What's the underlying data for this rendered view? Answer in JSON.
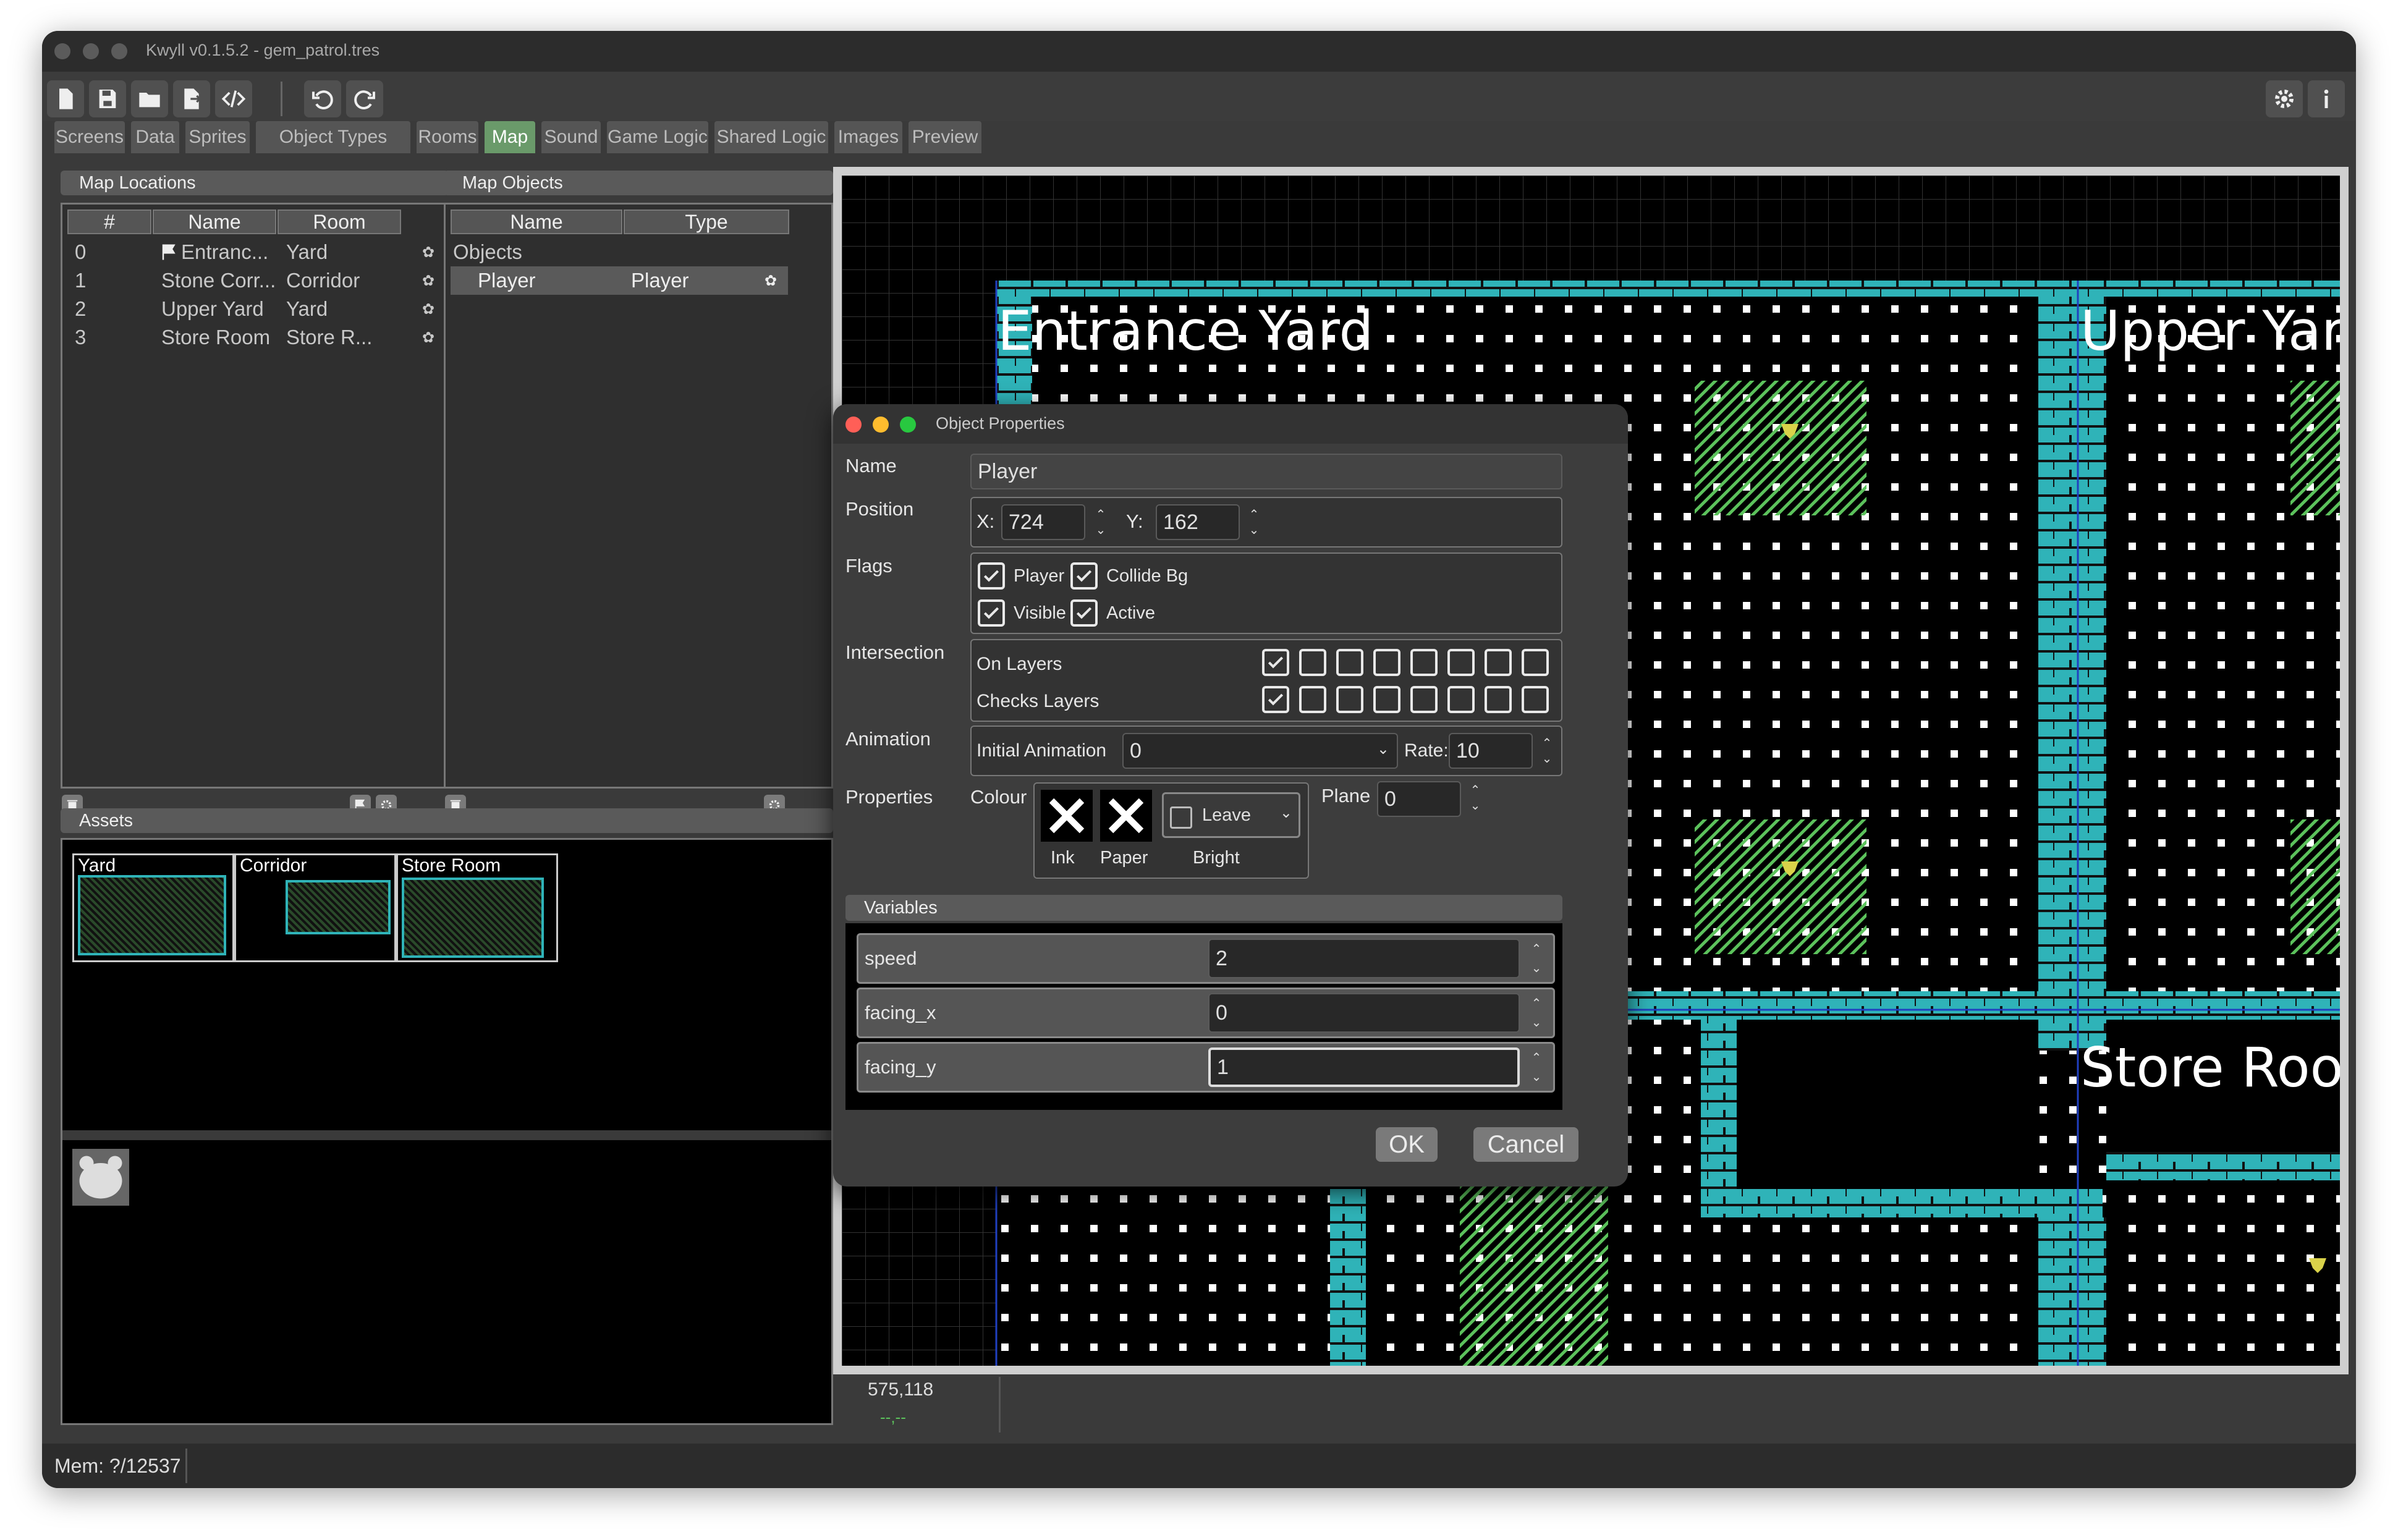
{
  "window": {
    "title": "Kwyll v0.1.5.2 - gem_patrol.tres"
  },
  "tabs": [
    "Screens",
    "Data",
    "Sprites",
    "Object Types",
    "Rooms",
    "Map",
    "Sound",
    "Game Logic",
    "Shared Logic",
    "Images",
    "Preview"
  ],
  "active_tab": "Map",
  "map_locations": {
    "title": "Map Locations",
    "columns": [
      "#",
      "Name",
      "Room"
    ],
    "rows": [
      {
        "index": "0",
        "name": "Entranc...",
        "room": "Yard"
      },
      {
        "index": "1",
        "name": "Stone Corr...",
        "room": "Corridor"
      },
      {
        "index": "2",
        "name": "Upper Yard",
        "room": "Yard"
      },
      {
        "index": "3",
        "name": "Store Room",
        "room": "Store R..."
      }
    ]
  },
  "map_objects": {
    "title": "Map Objects",
    "columns": [
      "Name",
      "Type"
    ],
    "group": "Objects",
    "rows": [
      {
        "name": "Player",
        "type": "Player"
      }
    ]
  },
  "assets": {
    "title": "Assets",
    "thumbs": [
      "Yard",
      "Corridor",
      "Store Room"
    ]
  },
  "map": {
    "labels": [
      "Entrance Yard",
      "Upper Yard",
      "Store Room"
    ],
    "coords": "575,118",
    "coords_sub": "--,--"
  },
  "status": {
    "mem": "Mem: ?/12537"
  },
  "dialog": {
    "title": "Object Properties",
    "name_label": "Name",
    "name_value": "Player",
    "position_label": "Position",
    "x_label": "X:",
    "x_value": "724",
    "y_label": "Y:",
    "y_value": "162",
    "flags_label": "Flags",
    "flags": [
      {
        "label": "Player",
        "checked": true
      },
      {
        "label": "Collide Bg",
        "checked": true
      },
      {
        "label": "Visible",
        "checked": true
      },
      {
        "label": "Active",
        "checked": true
      }
    ],
    "intersection_label": "Intersection",
    "on_layers_label": "On Layers",
    "checks_layers_label": "Checks Layers",
    "animation_label": "Animation",
    "initial_animation_label": "Initial Animation",
    "initial_animation_value": "0",
    "rate_label": "Rate:",
    "rate_value": "10",
    "properties_label": "Properties",
    "colour_label": "Colour",
    "ink_label": "Ink",
    "paper_label": "Paper",
    "bright_label": "Bright",
    "bright_value": "Leave",
    "plane_label": "Plane",
    "plane_value": "0",
    "variables_title": "Variables",
    "variables": [
      {
        "name": "speed",
        "value": "2"
      },
      {
        "name": "facing_x",
        "value": "0"
      },
      {
        "name": "facing_y",
        "value": "1"
      }
    ],
    "ok_label": "OK",
    "cancel_label": "Cancel"
  },
  "colors": {
    "accent_tab": "#6a9a6a",
    "wall": "#2fb3b8",
    "grass": "#5cc25c",
    "gem": "#d9d24a"
  }
}
